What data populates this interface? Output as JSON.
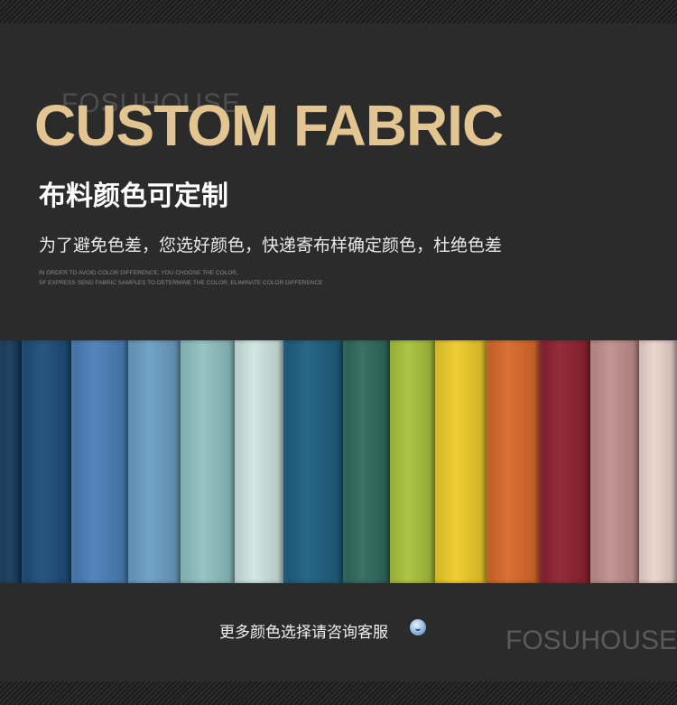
{
  "brand": {
    "watermark_top": "FOSUHOUSE",
    "watermark_bottom": "FOSUHOUSE"
  },
  "header": {
    "headline": "CUSTOM FABRIC",
    "subtitle": "布料颜色可定制",
    "description": "为了避免色差，您选好颜色，快递寄布样确定颜色，杜绝色差",
    "english_note_line1": "IN ORDER TO AVOID COLOR DIFFERENCE, YOU CHOOSE THE COLOR,",
    "english_note_line2": "SF EXPRESS SEND FABRIC SAMPLES TO DETERMINE THE COLOR, ELIMINATE COLOR DIFFERENCE"
  },
  "colors": {
    "headline": "#e2c590",
    "background": "#2b2b2b"
  },
  "swatches": [
    "#163b5e",
    "#1d4d78",
    "#4a7fb8",
    "#6a9ec4",
    "#8fc1c2",
    "#cfe6e2",
    "#1d5f82",
    "#2f6a5d",
    "#aac23c",
    "#efcc2a",
    "#d9692a",
    "#8e2230",
    "#c08f8d",
    "#ecd4cc"
  ],
  "footer": {
    "contact_text": "更多颜色选择请咨询客服",
    "emoji_icon": "smile-emoji-icon"
  }
}
